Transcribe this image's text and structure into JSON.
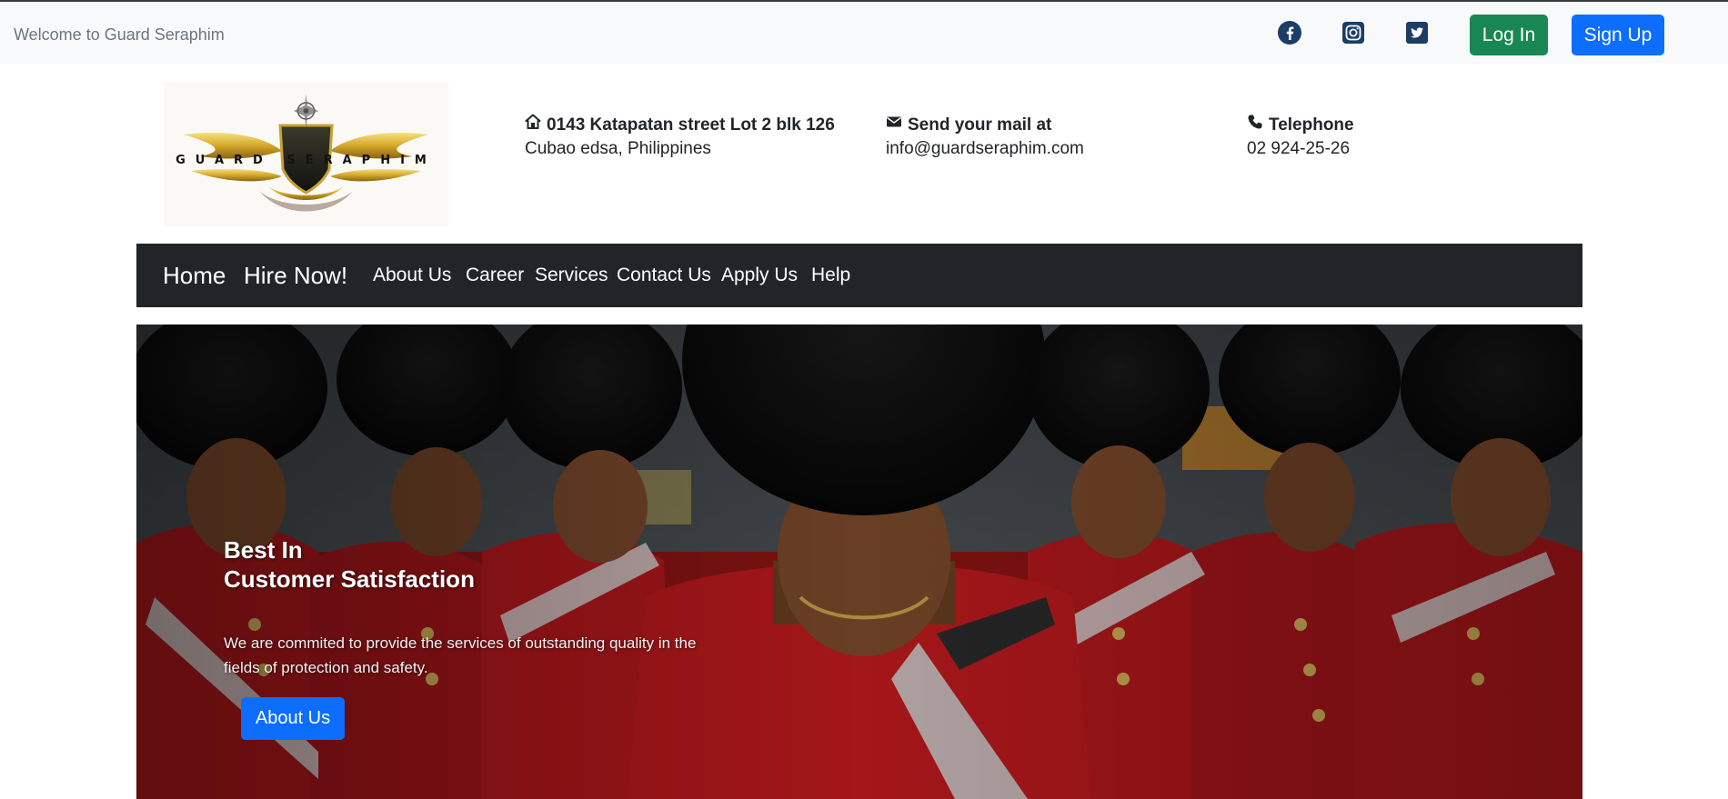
{
  "topbar": {
    "welcome": "Welcome to Guard Seraphim",
    "social": [
      {
        "icon": "facebook-icon"
      },
      {
        "icon": "instagram-icon"
      },
      {
        "icon": "twitter-icon"
      }
    ],
    "login_label": "Log In",
    "signup_label": "Sign Up"
  },
  "header": {
    "logo_text": "GUARD SERAPHIM",
    "address": {
      "icon": "house-icon",
      "title": "0143 Katapatan street Lot 2 blk 126",
      "detail": "Cubao edsa, Philippines"
    },
    "mail": {
      "icon": "envelope-icon",
      "title": "Send your mail at",
      "detail": "info@guardseraphim.com"
    },
    "phone": {
      "icon": "phone-icon",
      "title": "Telephone",
      "detail": "02 924-25-26"
    }
  },
  "nav": {
    "brand_home": "Home",
    "brand_hire": "Hire Now!",
    "items": [
      "About Us",
      "Career",
      "Services",
      "Contact Us",
      "Apply Us",
      "Help"
    ]
  },
  "hero": {
    "title_line1": "Best In",
    "title_line2": "Customer Satisfaction",
    "text": "We are commited to provide the services of outstanding quality in the fields of protection and safety.",
    "button_label": "About Us"
  },
  "colors": {
    "topbar_bg": "#f8f9fa",
    "navbar_bg": "#212529",
    "login_btn": "#198754",
    "signup_btn": "#0d6efd",
    "social_icon": "#1b3d66"
  }
}
